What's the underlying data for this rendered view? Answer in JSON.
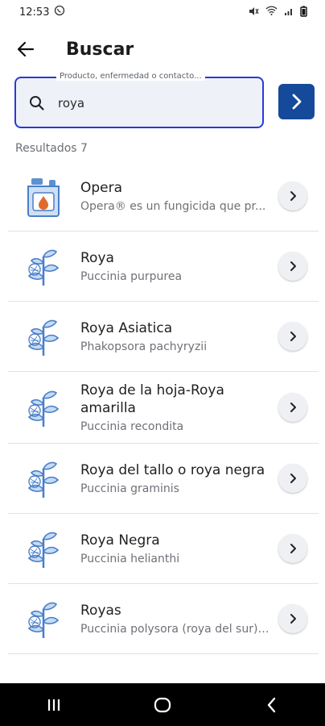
{
  "status_bar": {
    "time": "12:53"
  },
  "header": {
    "title": "Buscar"
  },
  "search": {
    "label": "Producto, enfermedad o contacto...",
    "value": "roya"
  },
  "results": {
    "label": "Resultados 7",
    "items": [
      {
        "title": "Opera",
        "subtitle": "Opera® es un fungicida que pr...",
        "icon": "product-jug-icon"
      },
      {
        "title": "Roya",
        "subtitle": "Puccinia purpurea",
        "icon": "plant-disease-icon"
      },
      {
        "title": "Roya Asiatica",
        "subtitle": "Phakopsora pachyryzii",
        "icon": "plant-disease-icon"
      },
      {
        "title": "Roya de la hoja-Roya amarilla",
        "subtitle": "Puccinia recondita",
        "icon": "plant-disease-icon"
      },
      {
        "title": "Roya del tallo o roya negra",
        "subtitle": "Puccinia graminis",
        "icon": "plant-disease-icon"
      },
      {
        "title": "Roya Negra",
        "subtitle": "Puccinia helianthi",
        "icon": "plant-disease-icon"
      },
      {
        "title": "Royas",
        "subtitle": "Puccinia polysora (roya del sur) ...",
        "icon": "plant-disease-icon"
      }
    ]
  },
  "colors": {
    "accent": "#154a9a",
    "focus": "#2b39d6",
    "icon_blue": "#4a7fc8"
  }
}
